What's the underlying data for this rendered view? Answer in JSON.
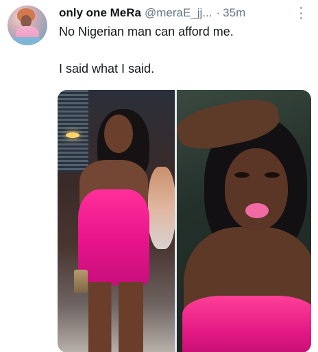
{
  "tweet": {
    "display_name": "only one MeRa",
    "handle": "@meraE_jj...",
    "separator": "·",
    "time": "35m",
    "text_line_1": "No Nigerian man can afford me.",
    "text_line_2": "I said what I said.",
    "more_icon": "vertical-ellipsis-icon"
  },
  "media": {
    "count": 2
  }
}
